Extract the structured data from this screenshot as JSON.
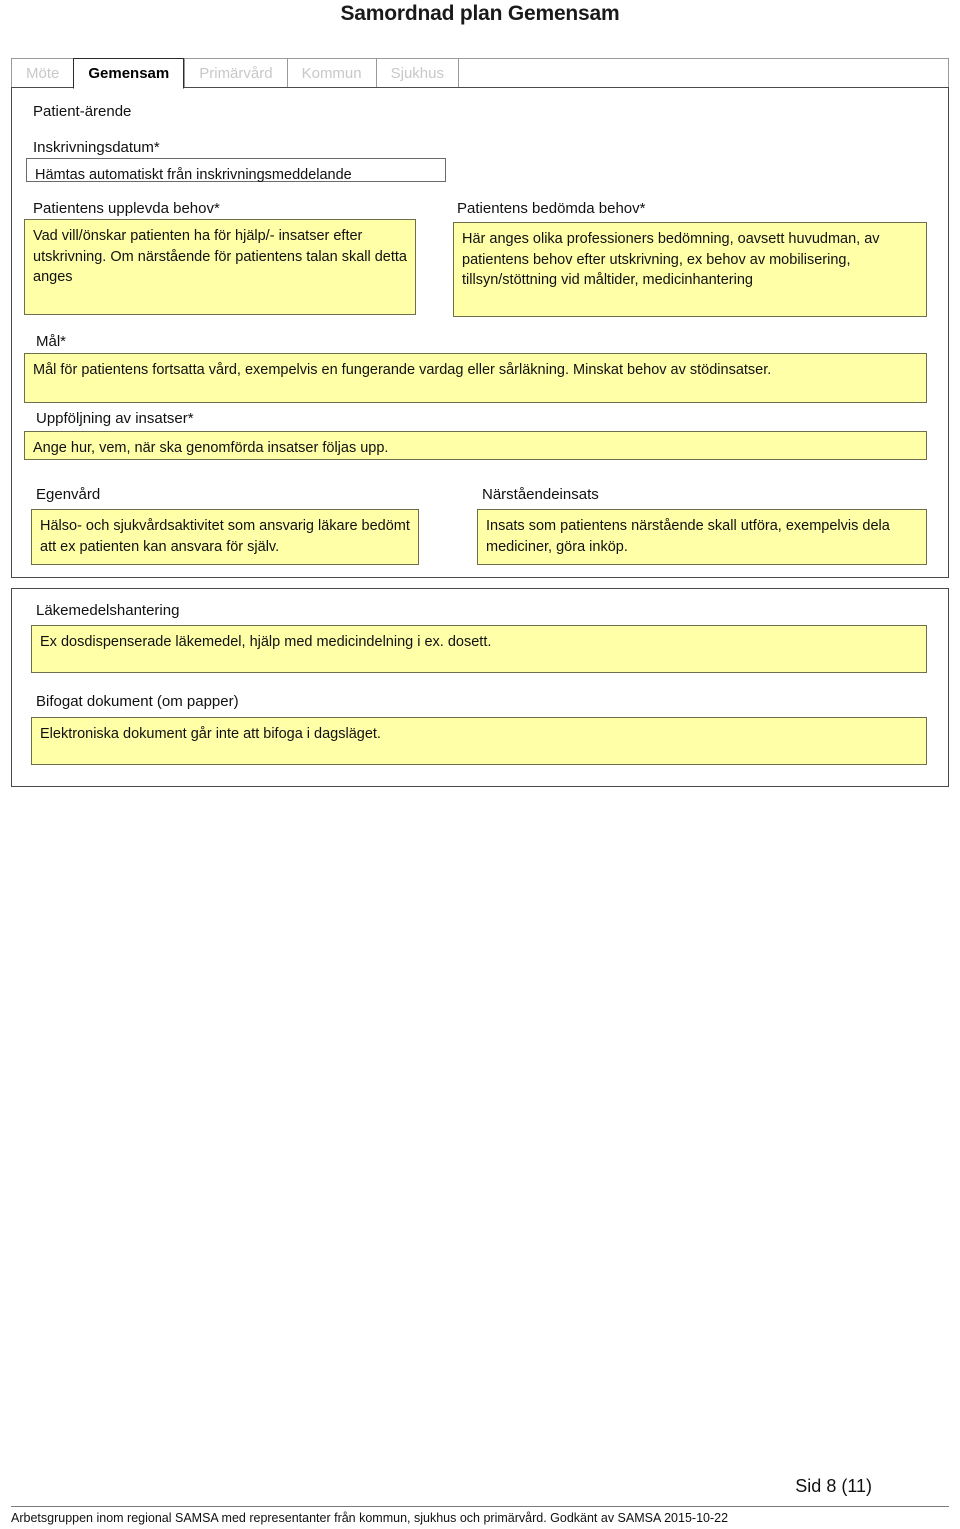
{
  "document": {
    "title": "Samordnad plan Gemensam"
  },
  "tabs": [
    {
      "label": "Möte",
      "active": false
    },
    {
      "label": "Gemensam",
      "active": true
    },
    {
      "label": "Primärvård",
      "active": false
    },
    {
      "label": "Kommun",
      "active": false
    },
    {
      "label": "Sjukhus",
      "active": false
    }
  ],
  "form": {
    "section_heading": "Patient-ärende",
    "fields": {
      "inskrivningsdatum": {
        "label": "Inskrivningsdatum*",
        "value": "Hämtas automatiskt från inskrivningsmeddelande"
      },
      "upplevda_behov": {
        "label": "Patientens upplevda behov*",
        "value": "Vad vill/önskar patienten ha för hjälp/- insatser efter utskrivning. Om närstående för patientens talan skall detta anges"
      },
      "bedomda_behov": {
        "label": "Patientens bedömda behov*",
        "value": "Här anges olika professioners bedömning, oavsett huvudman, av patientens behov efter utskrivning, ex behov av mobilisering, tillsyn/stöttning vid måltider, medicinhantering"
      },
      "mal": {
        "label": "Mål*",
        "value": "Mål för patientens fortsatta vård, exempelvis en fungerande vardag eller sårläkning. Minskat behov av stödinsatser."
      },
      "uppfoljning": {
        "label": "Uppföljning av insatser*",
        "value": "Ange hur, vem, när ska genomförda insatser följas upp."
      },
      "egenvard": {
        "label": "Egenvård",
        "value": "Hälso- och sjukvårdsaktivitet som ansvarig läkare bedömt att ex patienten kan ansvara för själv."
      },
      "narstaendeinsats": {
        "label": "Närståendeinsats",
        "value": "Insats som patientens närstående skall utföra, exempelvis dela mediciner, göra inköp."
      },
      "lakemedelshantering": {
        "label": "Läkemedelshantering",
        "value": "Ex dosdispenserade läkemedel, hjälp med medicindelning i ex. dosett."
      },
      "bifogat_dokument": {
        "label": "Bifogat dokument (om papper)",
        "value": "Elektroniska dokument går inte att bifoga i dagsläget."
      }
    }
  },
  "footer": {
    "page_number": "Sid 8 (11)",
    "note": "Arbetsgruppen inom regional SAMSA med representanter från kommun, sjukhus och primärvård. Godkänt av SAMSA 2015-10-22"
  },
  "colors": {
    "highlight_yellow": "#FFFFA8",
    "box_border": "#585858",
    "inactive_tab_text": "#C8C8C8",
    "panel_border": "#4A4A4A"
  }
}
